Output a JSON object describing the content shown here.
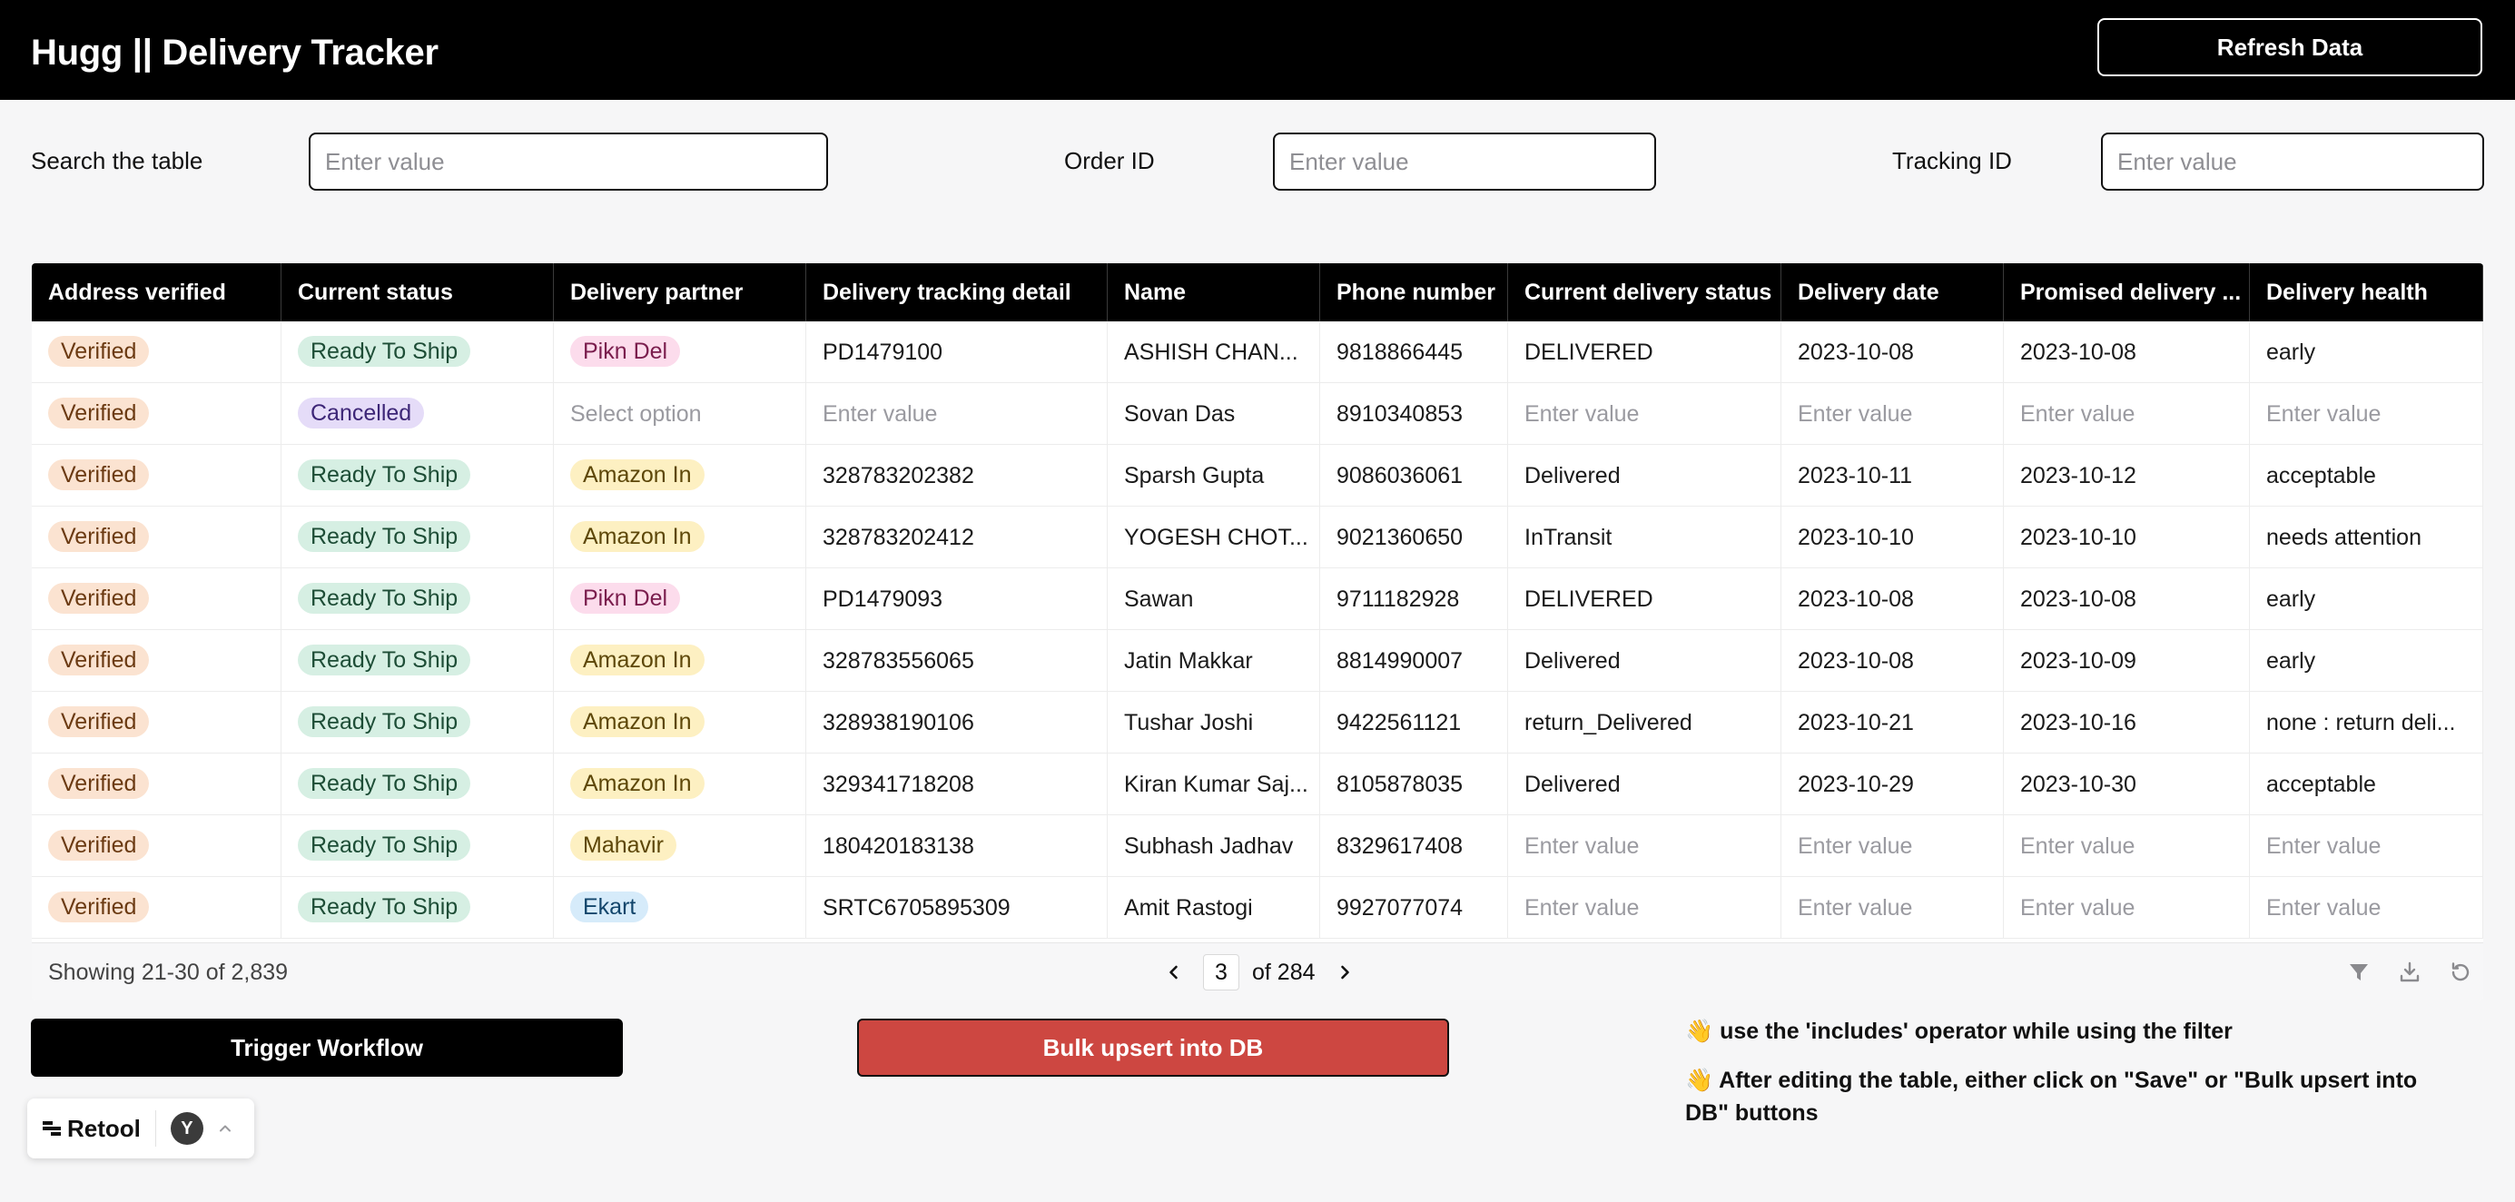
{
  "header": {
    "title": "Hugg || Delivery Tracker",
    "refresh_label": "Refresh Data"
  },
  "filters": {
    "search": {
      "label": "Search the table",
      "placeholder": "Enter value"
    },
    "order_id": {
      "label": "Order ID",
      "placeholder": "Enter value"
    },
    "tracking_id": {
      "label": "Tracking ID",
      "placeholder": "Enter value"
    }
  },
  "table": {
    "columns": [
      "Address verified",
      "Current status",
      "Delivery partner",
      "Delivery tracking detail",
      "Name",
      "Phone number",
      "Current delivery status",
      "Delivery date",
      "Promised delivery ...",
      "Delivery health"
    ],
    "placeholder_value": "Enter value",
    "placeholder_option": "Select option",
    "rows": [
      {
        "address": "Verified",
        "status": "Ready To Ship",
        "partner": "Pikn Del",
        "tracking": "PD1479100",
        "name": "ASHISH CHAN...",
        "phone": "9818866445",
        "delivery_status": "DELIVERED",
        "delivery_date": "2023-10-08",
        "promised": "2023-10-08",
        "health": "early"
      },
      {
        "address": "Verified",
        "status": "Cancelled",
        "partner": "",
        "tracking": "",
        "name": "Sovan Das",
        "phone": "8910340853",
        "delivery_status": "",
        "delivery_date": "",
        "promised": "",
        "health": ""
      },
      {
        "address": "Verified",
        "status": "Ready To Ship",
        "partner": "Amazon In",
        "tracking": "328783202382",
        "name": "Sparsh Gupta",
        "phone": "9086036061",
        "delivery_status": "Delivered",
        "delivery_date": "2023-10-11",
        "promised": "2023-10-12",
        "health": "acceptable"
      },
      {
        "address": "Verified",
        "status": "Ready To Ship",
        "partner": "Amazon In",
        "tracking": "328783202412",
        "name": "YOGESH CHOT...",
        "phone": "9021360650",
        "delivery_status": "InTransit",
        "delivery_date": "2023-10-10",
        "promised": "2023-10-10",
        "health": "needs attention"
      },
      {
        "address": "Verified",
        "status": "Ready To Ship",
        "partner": "Pikn Del",
        "tracking": "PD1479093",
        "name": "Sawan",
        "phone": "9711182928",
        "delivery_status": "DELIVERED",
        "delivery_date": "2023-10-08",
        "promised": "2023-10-08",
        "health": "early"
      },
      {
        "address": "Verified",
        "status": "Ready To Ship",
        "partner": "Amazon In",
        "tracking": "328783556065",
        "name": "Jatin Makkar",
        "phone": "8814990007",
        "delivery_status": "Delivered",
        "delivery_date": "2023-10-08",
        "promised": "2023-10-09",
        "health": "early"
      },
      {
        "address": "Verified",
        "status": "Ready To Ship",
        "partner": "Amazon In",
        "tracking": "328938190106",
        "name": "Tushar Joshi",
        "phone": "9422561121",
        "delivery_status": "return_Delivered",
        "delivery_date": "2023-10-21",
        "promised": "2023-10-16",
        "health": "none : return deli..."
      },
      {
        "address": "Verified",
        "status": "Ready To Ship",
        "partner": "Amazon In",
        "tracking": "329341718208",
        "name": "Kiran Kumar Saj...",
        "phone": "8105878035",
        "delivery_status": "Delivered",
        "delivery_date": "2023-10-29",
        "promised": "2023-10-30",
        "health": "acceptable"
      },
      {
        "address": "Verified",
        "status": "Ready To Ship",
        "partner": "Mahavir",
        "tracking": "180420183138",
        "name": "Subhash Jadhav",
        "phone": "8329617408",
        "delivery_status": "",
        "delivery_date": "",
        "promised": "",
        "health": ""
      },
      {
        "address": "Verified",
        "status": "Ready To Ship",
        "partner": "Ekart",
        "tracking": "SRTC6705895309",
        "name": "Amit Rastogi",
        "phone": "9927077074",
        "delivery_status": "",
        "delivery_date": "",
        "promised": "",
        "health": ""
      }
    ]
  },
  "tag_colors": {
    "Verified": {
      "bg": "#fbe3d1",
      "fg": "#6b3a12"
    },
    "Ready To Ship": {
      "bg": "#d6efe3",
      "fg": "#1d4d36"
    },
    "Cancelled": {
      "bg": "#e5dcf8",
      "fg": "#3d2677"
    },
    "Pikn Del": {
      "bg": "#fcdcec",
      "fg": "#7a1d4d"
    },
    "Amazon In": {
      "bg": "#fdf0c2",
      "fg": "#5d4708"
    },
    "Mahavir": {
      "bg": "#fdf0c2",
      "fg": "#5d4708"
    },
    "Ekart": {
      "bg": "#d6ebfa",
      "fg": "#12456b"
    }
  },
  "pagination": {
    "showing": "Showing 21-30 of 2,839",
    "page": "3",
    "of_label": "of 284"
  },
  "actions": {
    "trigger_label": "Trigger Workflow",
    "bulk_label": "Bulk upsert into DB"
  },
  "notes": {
    "note1": "👋 use the 'includes' operator while using the filter",
    "note2": "👋 After editing the table, either click on \"Save\" or \"Bulk upsert into DB\" buttons"
  },
  "retool": {
    "label": "Retool",
    "avatar": "Y"
  }
}
